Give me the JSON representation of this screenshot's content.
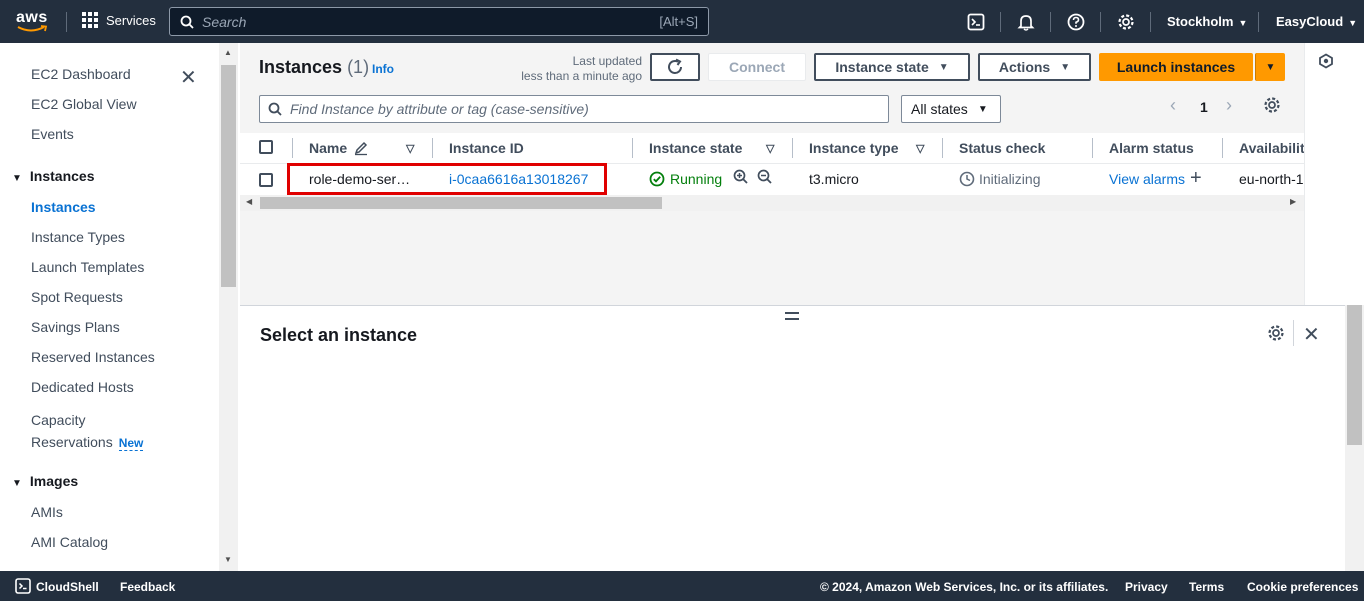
{
  "topnav": {
    "logo_text": "aws",
    "services_label": "Services",
    "search_placeholder": "Search",
    "search_shortcut": "[Alt+S]",
    "region": "Stockholm",
    "account": "EasyCloud"
  },
  "sidebar": {
    "items_top": [
      "EC2 Dashboard",
      "EC2 Global View",
      "Events"
    ],
    "section_instances": "Instances",
    "instances_items": [
      "Instances",
      "Instance Types",
      "Launch Templates",
      "Spot Requests",
      "Savings Plans",
      "Reserved Instances",
      "Dedicated Hosts"
    ],
    "capacity_line1": "Capacity",
    "capacity_line2": "Reservations",
    "new_badge": "New",
    "section_images": "Images",
    "images_items": [
      "AMIs",
      "AMI Catalog"
    ]
  },
  "main": {
    "title": "Instances",
    "count": "(1)",
    "info": "Info",
    "last_updated_label": "Last updated",
    "last_updated_value": "less than a minute ago",
    "connect": "Connect",
    "instance_state": "Instance state",
    "actions": "Actions",
    "launch": "Launch instances",
    "filter_placeholder": "Find Instance by attribute or tag (case-sensitive)",
    "states_filter": "All states",
    "page": "1"
  },
  "table": {
    "headers": [
      "Name",
      "Instance ID",
      "Instance state",
      "Instance type",
      "Status check",
      "Alarm status",
      "Availabilit"
    ],
    "row": {
      "name": "role-demo-ser…",
      "id": "i-0caa6616a13018267",
      "state": "Running",
      "type": "t3.micro",
      "status": "Initializing",
      "alarm": "View alarms",
      "az": "eu-north-1"
    }
  },
  "panel": {
    "title": "Select an instance"
  },
  "footer": {
    "cloudshell": "CloudShell",
    "feedback": "Feedback",
    "copyright": "© 2024, Amazon Web Services, Inc. or its affiliates.",
    "privacy": "Privacy",
    "terms": "Terms",
    "cookies": "Cookie preferences"
  },
  "colors": {
    "nav_bg": "#232f3e",
    "accent": "#ff9900",
    "link": "#0972d3",
    "success": "#037f0c",
    "highlight": "#e00000"
  }
}
